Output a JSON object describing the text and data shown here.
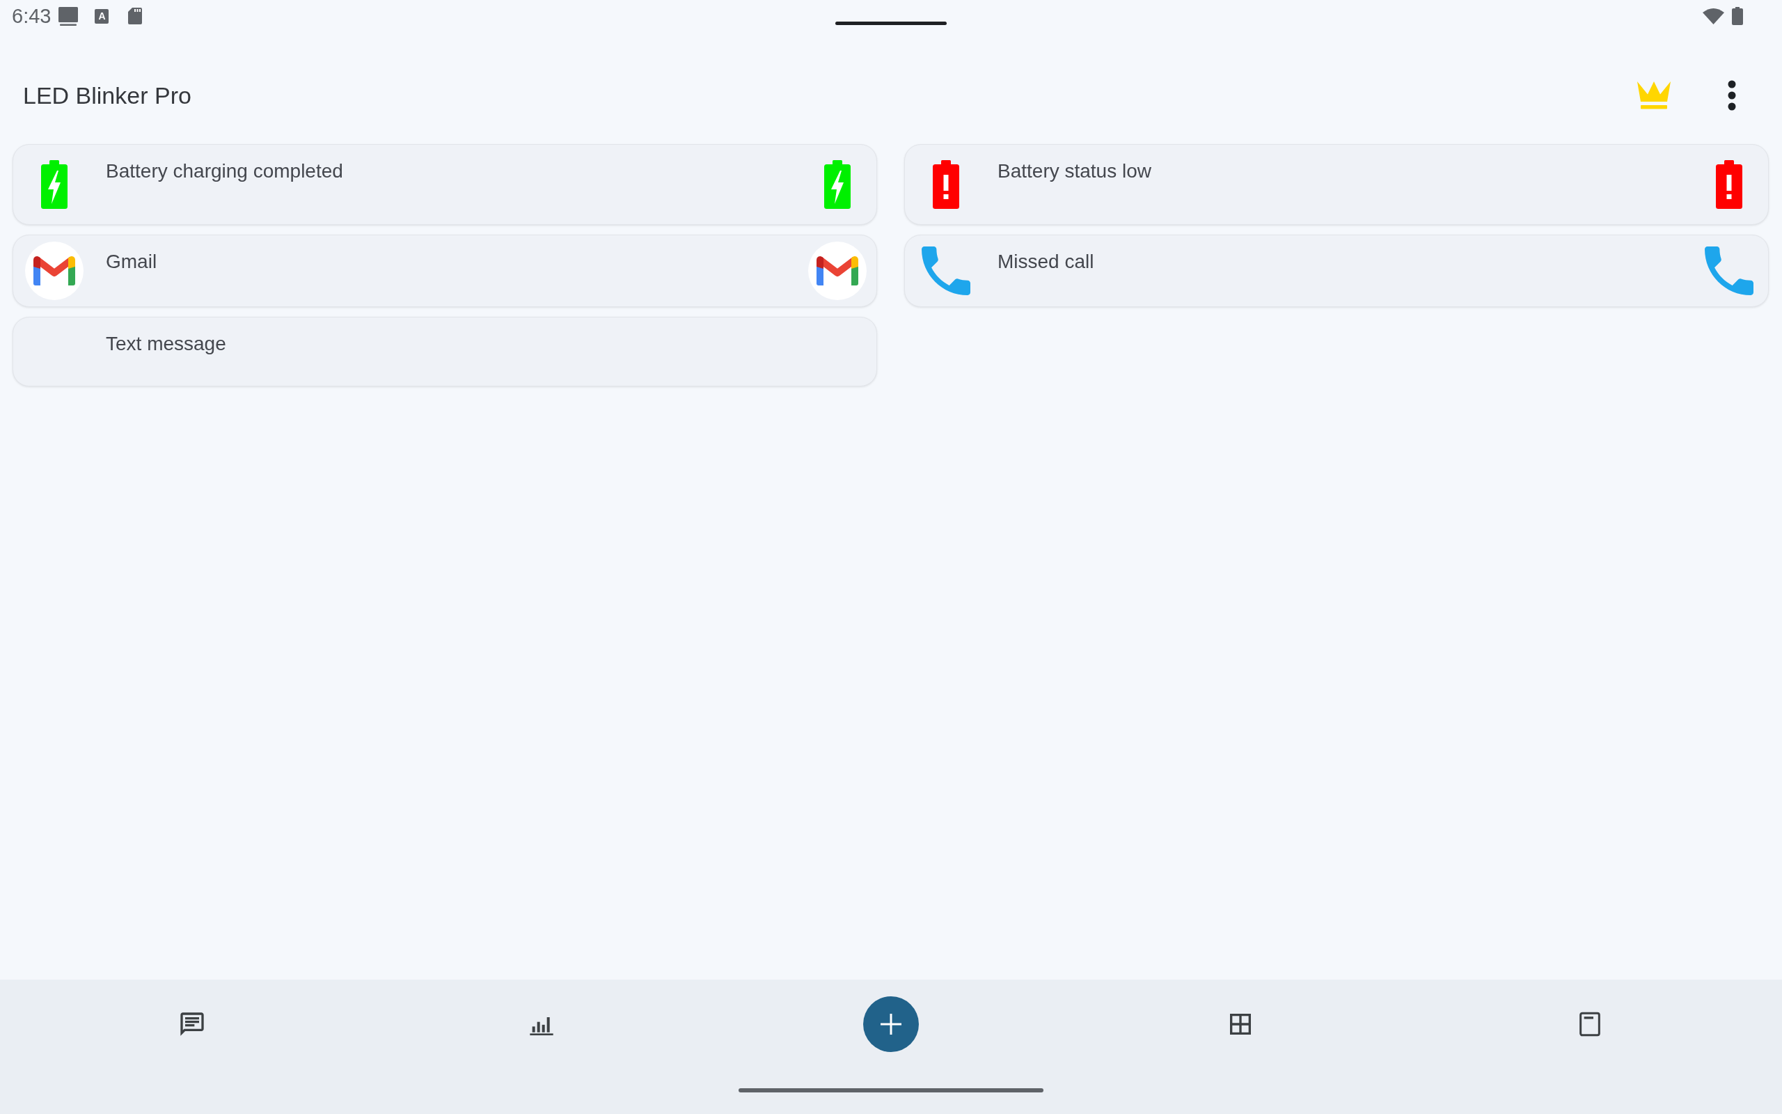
{
  "status_bar": {
    "time": "6:43",
    "letter_icon": "A"
  },
  "app_bar": {
    "title": "LED Blinker Pro"
  },
  "notifications": [
    {
      "title": "Battery charging completed",
      "kind": "battery_charging"
    },
    {
      "title": "Battery status low",
      "kind": "battery_low"
    },
    {
      "title": "Gmail",
      "kind": "gmail"
    },
    {
      "title": "Missed call",
      "kind": "phone"
    },
    {
      "title": "Text message",
      "kind": "plain"
    }
  ]
}
